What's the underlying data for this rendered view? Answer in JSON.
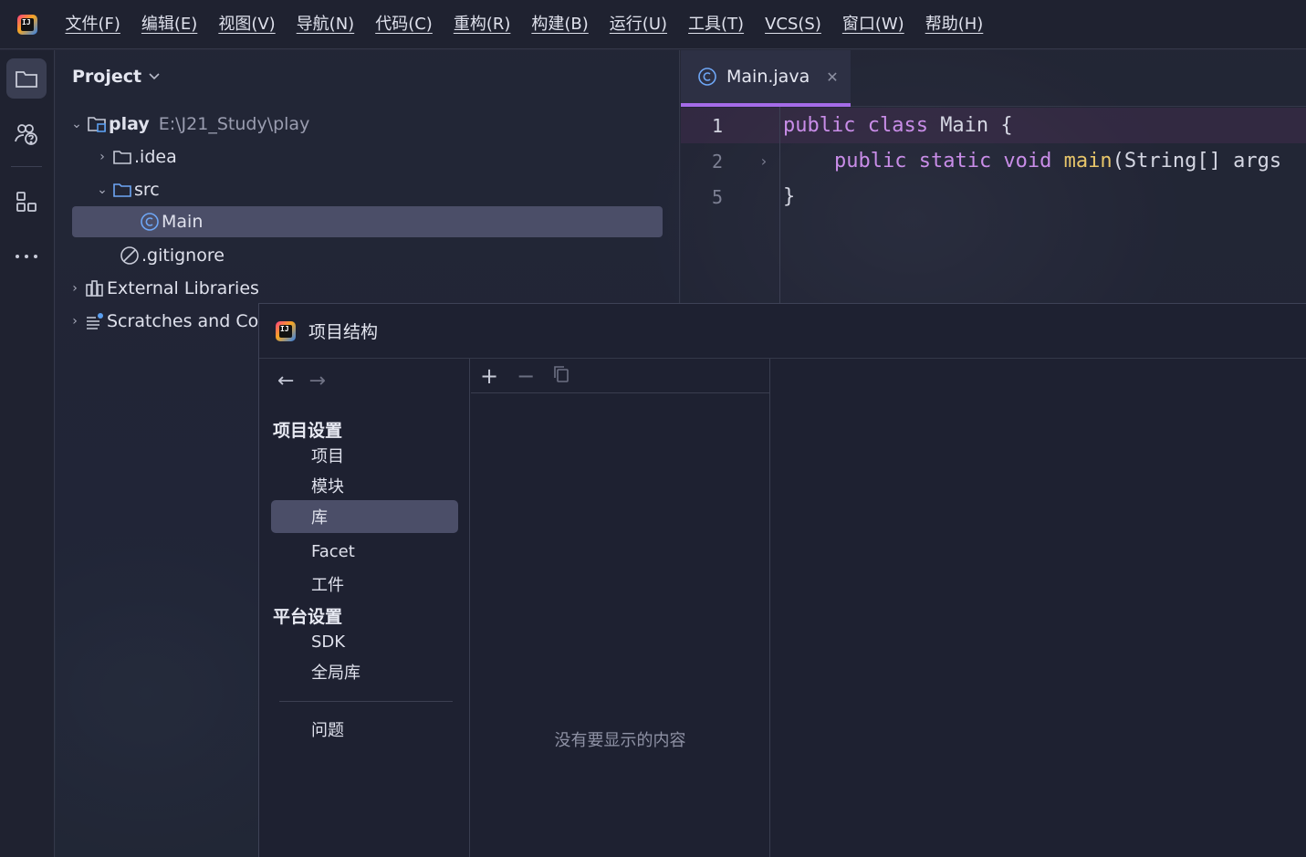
{
  "menu": {
    "logo_text": "IJ",
    "items": [
      "文件(F)",
      "编辑(E)",
      "视图(V)",
      "导航(N)",
      "代码(C)",
      "重构(R)",
      "构建(B)",
      "运行(U)",
      "工具(T)",
      "VCS(S)",
      "窗口(W)",
      "帮助(H)"
    ]
  },
  "project_panel": {
    "title": "Project",
    "tree": {
      "root_name": "play",
      "root_path": "E:\\J21_Study\\play",
      "idea": ".idea",
      "src": "src",
      "main": "Main",
      "gitignore": ".gitignore",
      "external_libraries": "External Libraries",
      "scratches": "Scratches and Co"
    }
  },
  "editor": {
    "tab_label": "Main.java",
    "lines": [
      {
        "num": "1",
        "kw": "public class ",
        "rest": "Main {"
      },
      {
        "num": "2",
        "kw": "public static void ",
        "fn": "main",
        "rest": "(String[] args"
      },
      {
        "num": "5",
        "rest": "}"
      }
    ]
  },
  "dialog": {
    "title": "项目结构",
    "categories": {
      "project_settings": "项目设置",
      "project": "项目",
      "modules": "模块",
      "libraries": "库",
      "facet": "Facet",
      "artifacts": "工件",
      "platform_settings": "平台设置",
      "sdk": "SDK",
      "global_libraries": "全局库",
      "problems": "问题"
    },
    "empty_message": "没有要显示的内容"
  },
  "colors": {
    "accent": "#a56be8",
    "keyword": "#c98de8",
    "function": "#e8c66a",
    "selection": "#4b4e68"
  }
}
